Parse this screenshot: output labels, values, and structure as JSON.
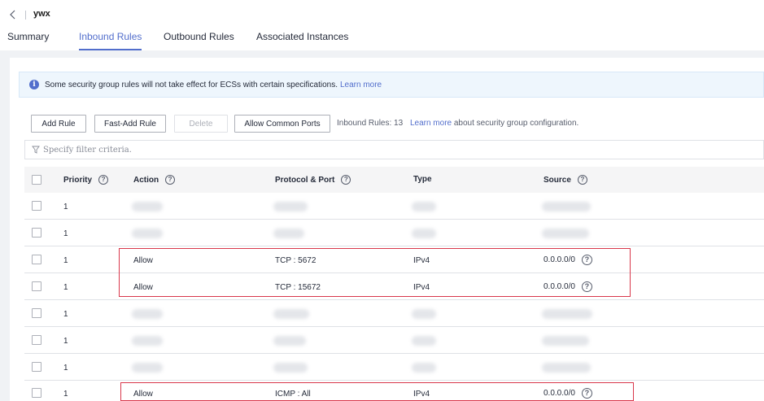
{
  "header": {
    "title": "ywx",
    "tabs": [
      {
        "label": "Summary",
        "active": false
      },
      {
        "label": "Inbound Rules",
        "active": true
      },
      {
        "label": "Outbound Rules",
        "active": false
      },
      {
        "label": "Associated Instances",
        "active": false
      }
    ]
  },
  "notice": {
    "text": "Some security group rules will not take effect for ECSs with certain specifications.",
    "link": "Learn more"
  },
  "toolbar": {
    "add_rule": "Add Rule",
    "fast_add_rule": "Fast-Add Rule",
    "delete": "Delete",
    "allow_common_ports": "Allow Common Ports",
    "rules_count": "Inbound Rules: 13",
    "learn_more": "Learn more",
    "learn_more_suffix": "about security group configuration."
  },
  "filter": {
    "placeholder": "Specify filter criteria."
  },
  "table": {
    "columns": [
      "Priority",
      "Action",
      "Protocol & Port",
      "Type",
      "Source"
    ],
    "help_glyph": "?",
    "rows": [
      {
        "priority": "1",
        "visible": false
      },
      {
        "priority": "1",
        "visible": false
      },
      {
        "priority": "1",
        "visible": true,
        "action": "Allow",
        "protocol_port": "TCP : 5672",
        "type": "IPv4",
        "source": "0.0.0.0/0"
      },
      {
        "priority": "1",
        "visible": true,
        "action": "Allow",
        "protocol_port": "TCP : 15672",
        "type": "IPv4",
        "source": "0.0.0.0/0"
      },
      {
        "priority": "1",
        "visible": false
      },
      {
        "priority": "1",
        "visible": false
      },
      {
        "priority": "1",
        "visible": false
      },
      {
        "priority": "1",
        "visible": true,
        "action": "Allow",
        "protocol_port": "ICMP : All",
        "type": "IPv4",
        "source": "0.0.0.0/0"
      }
    ]
  },
  "colors": {
    "accent": "#526ecc",
    "highlight": "#d9374b",
    "notice_bg": "#eef6fd"
  }
}
